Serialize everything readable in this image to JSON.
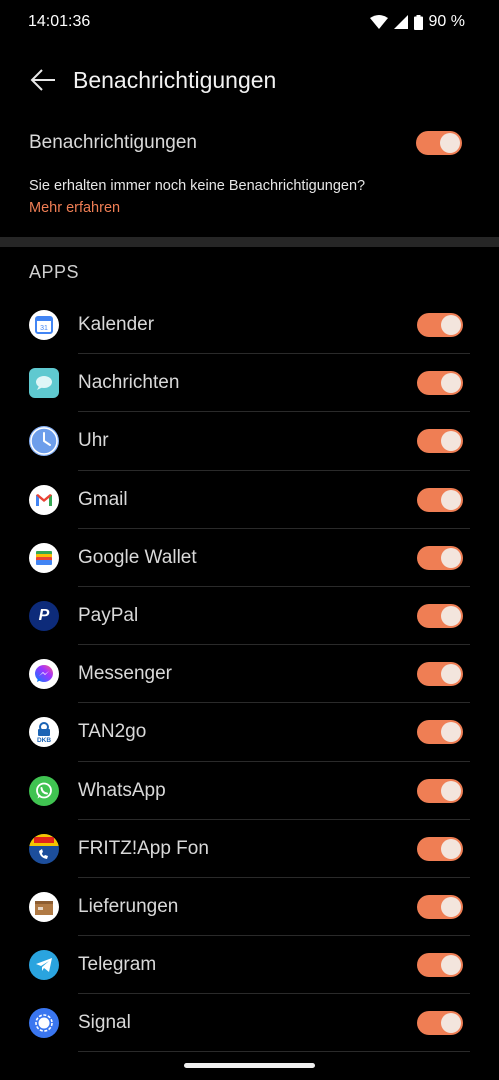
{
  "status_bar": {
    "time": "14:01:36",
    "battery": "90 %"
  },
  "header": {
    "title": "Benachrichtigungen"
  },
  "master": {
    "label": "Benachrichtigungen",
    "enabled": true,
    "hint": "Sie erhalten immer noch keine Benachrichtigungen?",
    "link": "Mehr erfahren"
  },
  "section": {
    "title": "APPS"
  },
  "apps": [
    {
      "name": "Kalender",
      "icon": "calendar-icon",
      "enabled": true
    },
    {
      "name": "Nachrichten",
      "icon": "messages-icon",
      "enabled": true
    },
    {
      "name": "Uhr",
      "icon": "clock-icon",
      "enabled": true
    },
    {
      "name": "Gmail",
      "icon": "gmail-icon",
      "enabled": true
    },
    {
      "name": "Google Wallet",
      "icon": "wallet-icon",
      "enabled": true
    },
    {
      "name": "PayPal",
      "icon": "paypal-icon",
      "enabled": true
    },
    {
      "name": "Messenger",
      "icon": "messenger-icon",
      "enabled": true
    },
    {
      "name": "TAN2go",
      "icon": "tan2go-icon",
      "enabled": true
    },
    {
      "name": "WhatsApp",
      "icon": "whatsapp-icon",
      "enabled": true
    },
    {
      "name": "FRITZ!App Fon",
      "icon": "fritz-icon",
      "enabled": true
    },
    {
      "name": "Lieferungen",
      "icon": "package-icon",
      "enabled": true
    },
    {
      "name": "Telegram",
      "icon": "telegram-icon",
      "enabled": true
    },
    {
      "name": "Signal",
      "icon": "signal-icon",
      "enabled": true
    }
  ],
  "colors": {
    "accent": "#ef7e54",
    "background": "#000000",
    "divider": "#262626"
  }
}
